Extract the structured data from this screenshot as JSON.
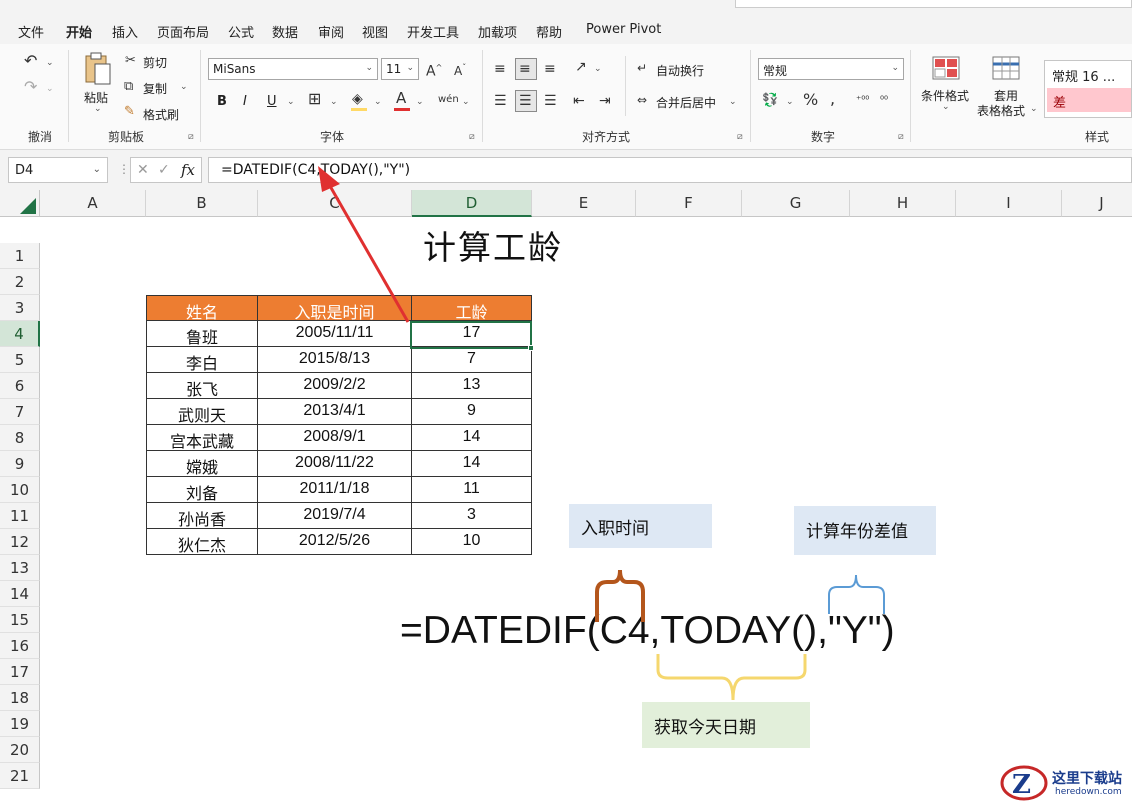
{
  "menu": {
    "tabs": [
      "文件",
      "开始",
      "插入",
      "页面布局",
      "公式",
      "数据",
      "审阅",
      "视图",
      "开发工具",
      "加载项",
      "帮助",
      "Power Pivot"
    ],
    "active_tab": "开始"
  },
  "ribbon": {
    "undo_group": "撤消",
    "clipboard": {
      "paste": "粘贴",
      "cut": "剪切",
      "copy": "复制",
      "format_painter": "格式刷",
      "group": "剪贴板"
    },
    "font": {
      "name": "MiSans",
      "size": "11",
      "bold": "B",
      "italic": "I",
      "underline": "U",
      "group": "字体"
    },
    "alignment": {
      "wrap": "自动换行",
      "merge": "合并后居中",
      "group": "对齐方式"
    },
    "number": {
      "format": "常规",
      "group": "数字"
    },
    "styles": {
      "conditional": "条件格式",
      "table_format_1": "套用",
      "table_format_2": "表格格式",
      "normal": "常规 16 ...",
      "bad": "差",
      "group": "样式"
    }
  },
  "formula_bar": {
    "cell_ref": "D4",
    "formula": "=DATEDIF(C4,TODAY(),\"Y\")",
    "fx": "fx"
  },
  "columns": [
    "A",
    "B",
    "C",
    "D",
    "E",
    "F",
    "G",
    "H",
    "I",
    "J"
  ],
  "active_column": "D",
  "rows": [
    "1",
    "2",
    "3",
    "4",
    "5",
    "6",
    "7",
    "8",
    "9",
    "10",
    "11",
    "12",
    "13",
    "14",
    "15",
    "16",
    "17",
    "18",
    "19",
    "20",
    "21"
  ],
  "active_row": "4",
  "sheet": {
    "title": "计算工龄",
    "headers": [
      "姓名",
      "入职是时间",
      "工龄"
    ],
    "records": [
      {
        "name": "鲁班",
        "date": "2005/11/11",
        "years": "17"
      },
      {
        "name": "李白",
        "date": "2015/8/13",
        "years": "7"
      },
      {
        "name": "张飞",
        "date": "2009/2/2",
        "years": "13"
      },
      {
        "name": "武则天",
        "date": "2013/4/1",
        "years": "9"
      },
      {
        "name": "宫本武藏",
        "date": "2008/9/1",
        "years": "14"
      },
      {
        "name": "嫦娥",
        "date": "2008/11/22",
        "years": "14"
      },
      {
        "name": "刘备",
        "date": "2011/1/18",
        "years": "11"
      },
      {
        "name": "孙尚香",
        "date": "2019/7/4",
        "years": "3"
      },
      {
        "name": "狄仁杰",
        "date": "2012/5/26",
        "years": "10"
      }
    ]
  },
  "annotations": {
    "hire_date": "入职时间",
    "year_diff": "计算年份差值",
    "today": "获取今天日期",
    "formula": "=DATEDIF(C4,TODAY(),\"Y\")"
  },
  "watermark": {
    "text": "这里下载站",
    "sub": "heredown.com"
  },
  "colors": {
    "header_fill": "#ed7d31",
    "accent_green": "#217346",
    "note_blue": "#dee8f4",
    "note_green": "#e2efda",
    "brace_brown": "#b4561c",
    "brace_blue": "#5b9bd5",
    "brace_yellow": "#f5d76e",
    "arrow_red": "#e03030"
  }
}
